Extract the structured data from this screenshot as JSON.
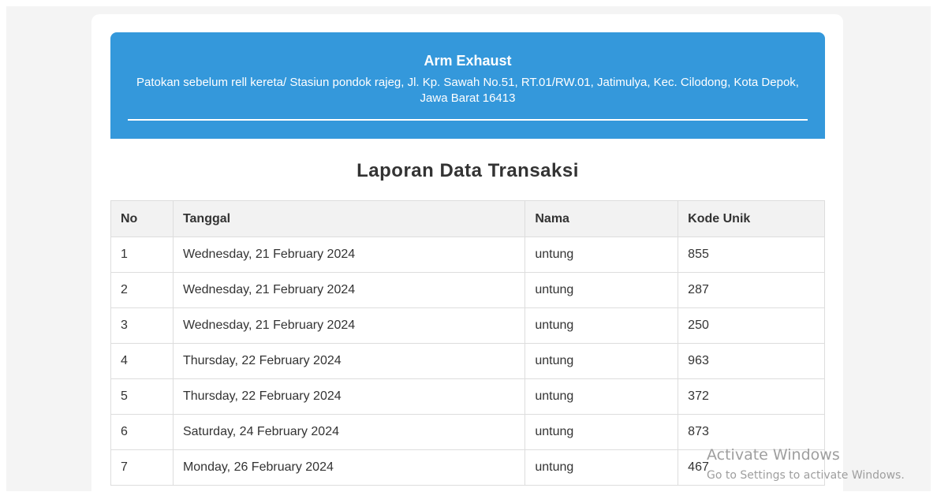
{
  "header": {
    "name": "Arm Exhaust",
    "address": "Patokan sebelum rell kereta/ Stasiun pondok rajeg, Jl. Kp. Sawah No.51, RT.01/RW.01, Jatimulya, Kec. Cilodong, Kota Depok, Jawa Barat 16413"
  },
  "report": {
    "title": "Laporan Data Transaksi"
  },
  "table": {
    "columns": [
      "No",
      "Tanggal",
      "Nama",
      "Kode Unik"
    ],
    "rows": [
      [
        "1",
        "Wednesday, 21 February 2024",
        "untung",
        "855"
      ],
      [
        "2",
        "Wednesday, 21 February 2024",
        "untung",
        "287"
      ],
      [
        "3",
        "Wednesday, 21 February 2024",
        "untung",
        "250"
      ],
      [
        "4",
        "Thursday, 22 February 2024",
        "untung",
        "963"
      ],
      [
        "5",
        "Thursday, 22 February 2024",
        "untung",
        "372"
      ],
      [
        "6",
        "Saturday, 24 February 2024",
        "untung",
        "873"
      ],
      [
        "7",
        "Monday, 26 February 2024",
        "untung",
        "467"
      ]
    ]
  },
  "watermark": {
    "title": "Activate Windows",
    "subtitle": "Go to Settings to activate Windows."
  },
  "colors": {
    "header_bg": "#3498db",
    "table_header_bg": "#f2f2f2",
    "border": "#dddddd"
  }
}
